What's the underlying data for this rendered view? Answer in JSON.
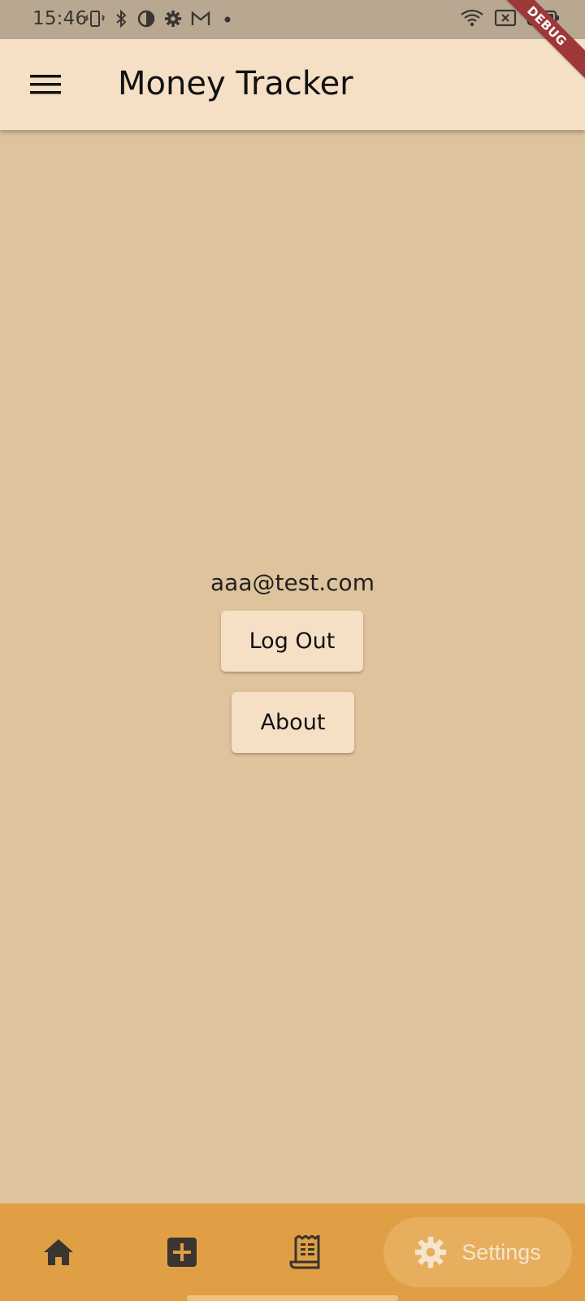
{
  "status_bar": {
    "time": "15:46",
    "left_icons": [
      "vibrate-icon",
      "bluetooth-icon",
      "data-saver-icon",
      "settings-icon",
      "gmail-icon",
      "dot-icon"
    ],
    "right_icons": [
      "wifi-icon",
      "no-sim-icon",
      "battery-icon"
    ]
  },
  "debug_banner": {
    "label": "DEBUG",
    "color": "#9E3838"
  },
  "app_bar": {
    "title": "Money Tracker",
    "menu_icon": "hamburger-menu-icon"
  },
  "content": {
    "email": "aaa@test.com",
    "logout_label": "Log Out",
    "about_label": "About"
  },
  "bottom_nav": {
    "items": [
      {
        "icon": "home-icon"
      },
      {
        "icon": "add-box-icon"
      },
      {
        "icon": "receipt-icon"
      },
      {
        "icon": "gear-icon",
        "label": "Settings",
        "selected": true
      }
    ]
  },
  "colors": {
    "background": "#DEC39C",
    "app_bar": "#F5E0C6",
    "button": "#F5E0C6",
    "bottom_nav": "#E09F45",
    "nav_selected_pill": "#E7AE5E"
  }
}
